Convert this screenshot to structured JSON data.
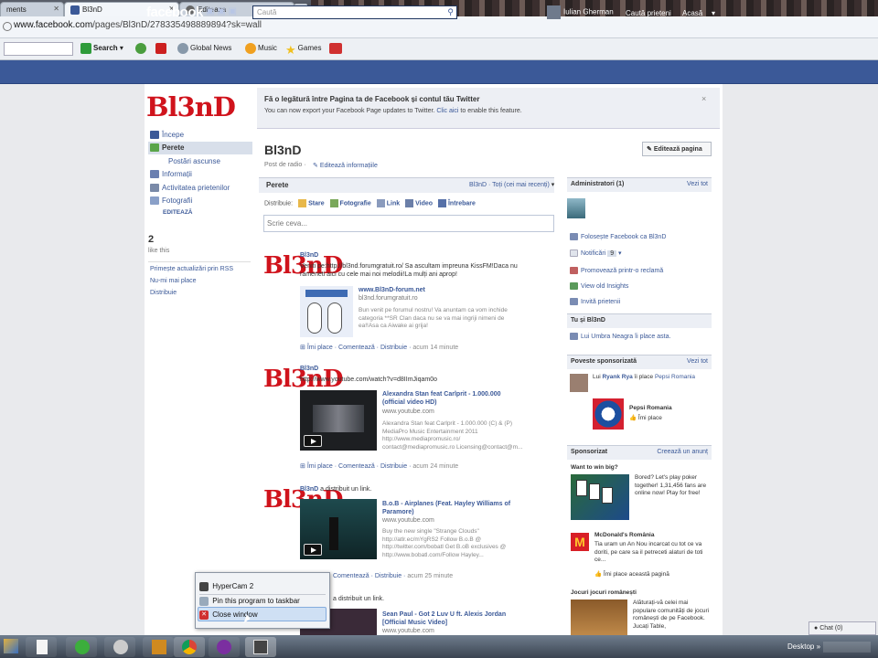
{
  "browser": {
    "tabs": [
      {
        "label": "ments"
      },
      {
        "label": "Bl3nD"
      },
      {
        "label": "Editeaza"
      }
    ],
    "new_tab": "+",
    "url_domain": "www.facebook.com",
    "url_path": "/pages/Bl3nD/278335498889894?sk=wall",
    "toolbar": {
      "search": "Search",
      "global_news": "Global News",
      "music": "Music",
      "games": "Games"
    }
  },
  "facebook": {
    "logo": "facebook",
    "search_placeholder": "Caută",
    "user": "Iulian Gherman",
    "find_friends": "Caută prieteni",
    "home": "Acasă"
  },
  "left": {
    "logo": "Bl3nD",
    "nav": [
      "Începe",
      "Perete",
      "Postări ascunse",
      "Informații",
      "Activitatea prietenilor",
      "Fotografii",
      "EDITEAZĂ"
    ],
    "likes_count": "2",
    "likes_label": "like this",
    "links": [
      "Primește actualizări prin RSS",
      "Nu-mi mai place",
      "Distribuie"
    ]
  },
  "twitter": {
    "title": "Fă o legătură între Pagina ta de Facebook și contul tău Twitter",
    "subtitle_a": "You can now export your Facebook Page updates to Twitter. ",
    "subtitle_link": "Clic aici",
    "subtitle_b": " to enable this feature.",
    "close": "×"
  },
  "page": {
    "title": "Bl3nD",
    "category": "Post de radio ·",
    "edit_info": "Editează informațiile",
    "edit_page": "Editează pagina"
  },
  "wall": {
    "label": "Perete",
    "filter": "Bl3nD · Toți (cei mai recenți)",
    "share_label": "Distribuie:",
    "share": [
      "Stare",
      "Fotografie",
      "Link",
      "Video",
      "Întrebare"
    ],
    "status_placeholder": "Scrie ceva...",
    "posts": [
      {
        "author": "Bl3nD",
        "text": "Veniti pe:http://bl3nd.forumgratuit.ro/ Sa ascultam impreuna KissFM!Daca nu rameneti aici cu cele mai noi melodii!La mulți ani aprop!",
        "att_title": "www.Bl3nD-forum.net",
        "att_domain": "bl3nd.forumgratuit.ro",
        "att_desc": "Bun venit pe forumul nostru! Va anuntam ca vom inchide categoria **SR Clan daca nu se va mai ingriji nimeni de ea!!Asa ca Aiwake ai grija!",
        "meta_a": "Îmi place · Comentează · Distribuie · ",
        "time": "acum 14 minute"
      },
      {
        "author": "Bl3nD",
        "text": "http://www.youtube.com/watch?v=d8IImJiqam0o",
        "att_title": "Alexandra Stan feat Carlprit - 1.000.000 (official video HD)",
        "att_domain": "www.youtube.com",
        "att_desc": "Alexandra Stan feat Carlprit - 1.000.000 (C) & (P) MediaPro Music Entertainment 2011 http://www.mediapromusic.ro/ contact@mediapromusic.ro Licensing@contact@m...",
        "meta_a": "Îmi place · Comentează · Distribuie · ",
        "time": "acum 24 minute"
      },
      {
        "author": "Bl3nD",
        "author_suffix": " a distribuit un link.",
        "att_title": "B.o.B - Airplanes (Feat. Hayley Williams of Paramore)",
        "att_domain": "www.youtube.com",
        "att_desc": "Buy the new single \"Strange Clouds\" http://atlr.ec/mYgRS2 Follow B.o.B @ http://twitter.com/bobatl Get B.oB exclusives @ http://www.bobatl.com/Follow Hayley...",
        "meta_a": "Comentează · Distribuie · ",
        "time": "acum 25 minute"
      },
      {
        "author_suffix": " a distribuit un link.",
        "att_title": "Sean Paul - Got 2 Luv U ft. Alexis Jordan [Official Music Video]",
        "att_domain": "www.youtube.com"
      }
    ]
  },
  "right": {
    "admins_title": "Administratori (1)",
    "see_all": "Vezi tot",
    "admin_links": [
      "Folosește Facebook ca Bl3nD",
      "Notificări",
      "Promovează printr-o reclamă",
      "View old Insights",
      "Invită prietenii"
    ],
    "notif_count": "9",
    "you_title": "Tu și Bl3nD",
    "you_text": "Lui Umbra Neagra îi place asta.",
    "story_title": "Poveste sponsorizată",
    "story_see": "Vezi tot",
    "story_text_a": "Lui ",
    "story_name": "Ryank Rya",
    "story_text_b": " îi place ",
    "story_page": "Pepsi Romania",
    "story_page2": "Pepsi Romania",
    "story_like": "Îmi place",
    "sponsored_title": "Sponsorizat",
    "create_ad": "Creează un anunț",
    "ads": [
      {
        "title": "Want to win big?",
        "text": "Bored? Let's play poker together! 1,31,456 fans are online now! Play for free!"
      },
      {
        "title": "McDonald's România",
        "text": "Tia uram un An Nou incarcat cu tot ce va doriti, pe care sa il petreceti alaturi de toti ce...",
        "like": "Îmi place această pagină"
      },
      {
        "title": "Jocuri jocuri românești",
        "text": "Alăturați-vă celei mai populare comunități de jocuri românești de pe Facebook. Jucați Table,"
      }
    ],
    "chat": "Chat (0)"
  },
  "context_menu": {
    "items": [
      "HyperCam 2",
      "Pin this program to taskbar",
      "Close window"
    ]
  },
  "taskbar": {
    "desktop": "Desktop"
  },
  "colors": {
    "fb_blue": "#3b5998",
    "brand_red": "#d0131c"
  }
}
